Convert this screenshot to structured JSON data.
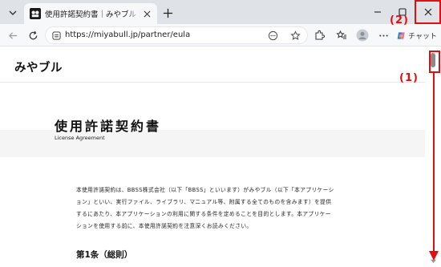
{
  "browser": {
    "tab": {
      "title": "使用許諾契約書｜みやブル｜ネットワーク"
    },
    "address_bar": {
      "url": "https://miyabull.jp/partner/eula"
    },
    "copilot_label": "チャット"
  },
  "page": {
    "site_logo": "みやブル",
    "title": "使用許諾契約書",
    "subtitle": "License Agreement",
    "intro_lines": [
      "本使用許諾契約は、BBSS株式会社（以下「BBSS」といいます）がみやブル（以下「本アプリケーシ",
      "ョン」といい、実行ファイル、ライブラリ、マニュアル等、附属する全てのものを含みます）を提供",
      "するにあたり、本アプリケーションの利用に関する条件を定めることを目的とします。本アプリケー",
      "ションを使用する前に、本使用許諾契約を注意深くお読みください。"
    ],
    "article_heading": "第1条（総則）"
  },
  "annotations": {
    "label_1": "(1)",
    "label_2": "(2)",
    "color": "#e01010"
  },
  "colors": {
    "tabstrip_bg": "#dfe3e8",
    "toolbar_bg": "#f7f8fa",
    "title_band_bg": "#f5f5f5"
  }
}
